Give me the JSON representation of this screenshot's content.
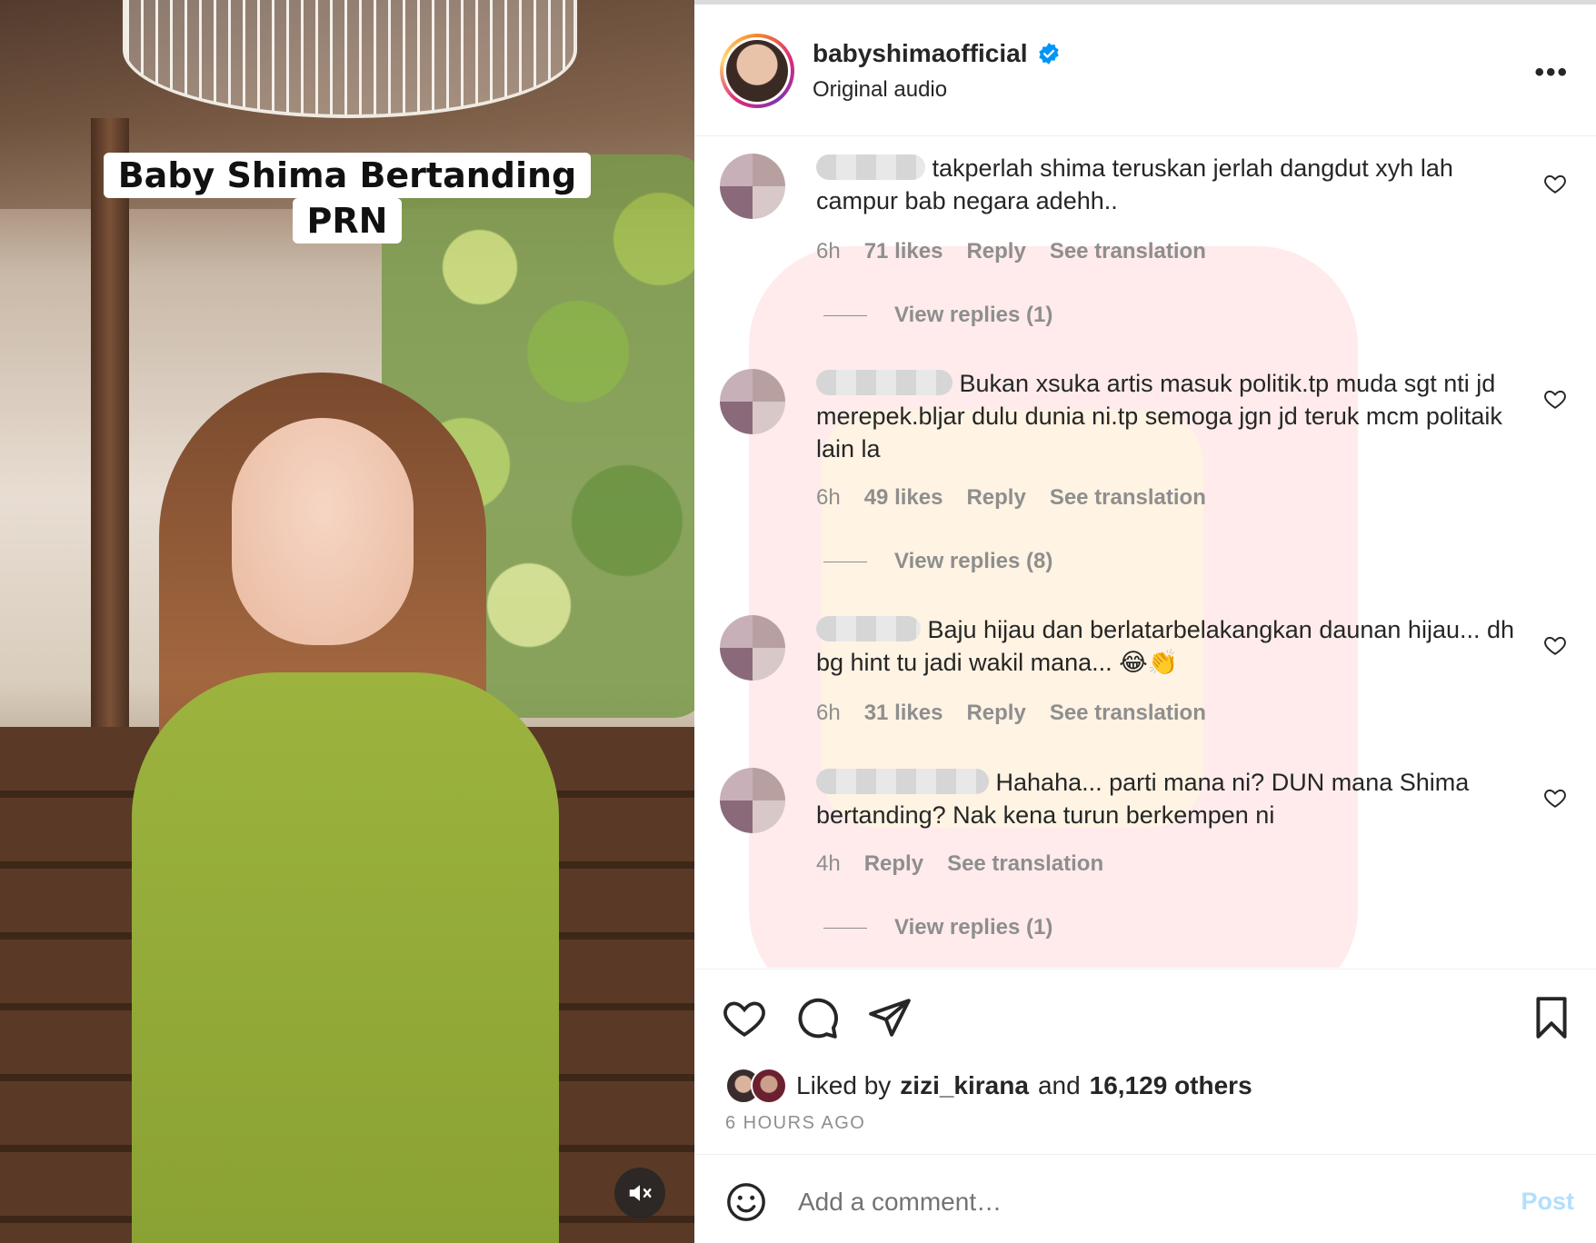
{
  "media": {
    "caption_line1": "Baby Shima Bertanding",
    "caption_line2": "PRN",
    "mute_icon": "speaker-muted-icon"
  },
  "header": {
    "username": "babyshimaofficial",
    "verified_icon": "verified-badge-icon",
    "subtitle": "Original audio",
    "more_label": "•••"
  },
  "comments": [
    {
      "text": "takperlah shima teruskan jerlah dangdut xyh lah campur bab negara adehh..",
      "time": "6h",
      "likes": "71 likes",
      "reply": "Reply",
      "translate": "See translation",
      "replies": "View replies (1)"
    },
    {
      "text": "Bukan xsuka artis masuk politik.tp muda sgt nti jd merepek.bljar dulu dunia ni.tp semoga jgn jd teruk mcm politaik lain la",
      "time": "6h",
      "likes": "49 likes",
      "reply": "Reply",
      "translate": "See translation",
      "replies": "View replies (8)"
    },
    {
      "text": "Baju hijau dan berlatarbelakangkan daunan hijau... dh bg hint tu jadi wakil mana... 😂👏",
      "time": "6h",
      "likes": "31 likes",
      "reply": "Reply",
      "translate": "See translation"
    },
    {
      "text": "Hahaha... parti mana ni? DUN mana Shima bertanding? Nak kena turun berkempen ni",
      "time": "4h",
      "reply": "Reply",
      "translate": "See translation",
      "replies": "View replies (1)"
    }
  ],
  "actions": {
    "like_icon": "heart-icon",
    "comment_icon": "comment-bubble-icon",
    "share_icon": "paper-plane-icon",
    "save_icon": "bookmark-icon",
    "liked_prefix": "Liked by",
    "liked_user": "zizi_kirana",
    "liked_and": "and",
    "liked_others": "16,129 others",
    "time_ago": "6 HOURS AGO"
  },
  "composer": {
    "emoji_icon": "smiley-icon",
    "placeholder": "Add a comment…",
    "post_label": "Post"
  },
  "colors": {
    "text": "#262626",
    "muted": "#8e8e8e",
    "verified": "#0095f6",
    "post_disabled": "#b2dffc"
  }
}
